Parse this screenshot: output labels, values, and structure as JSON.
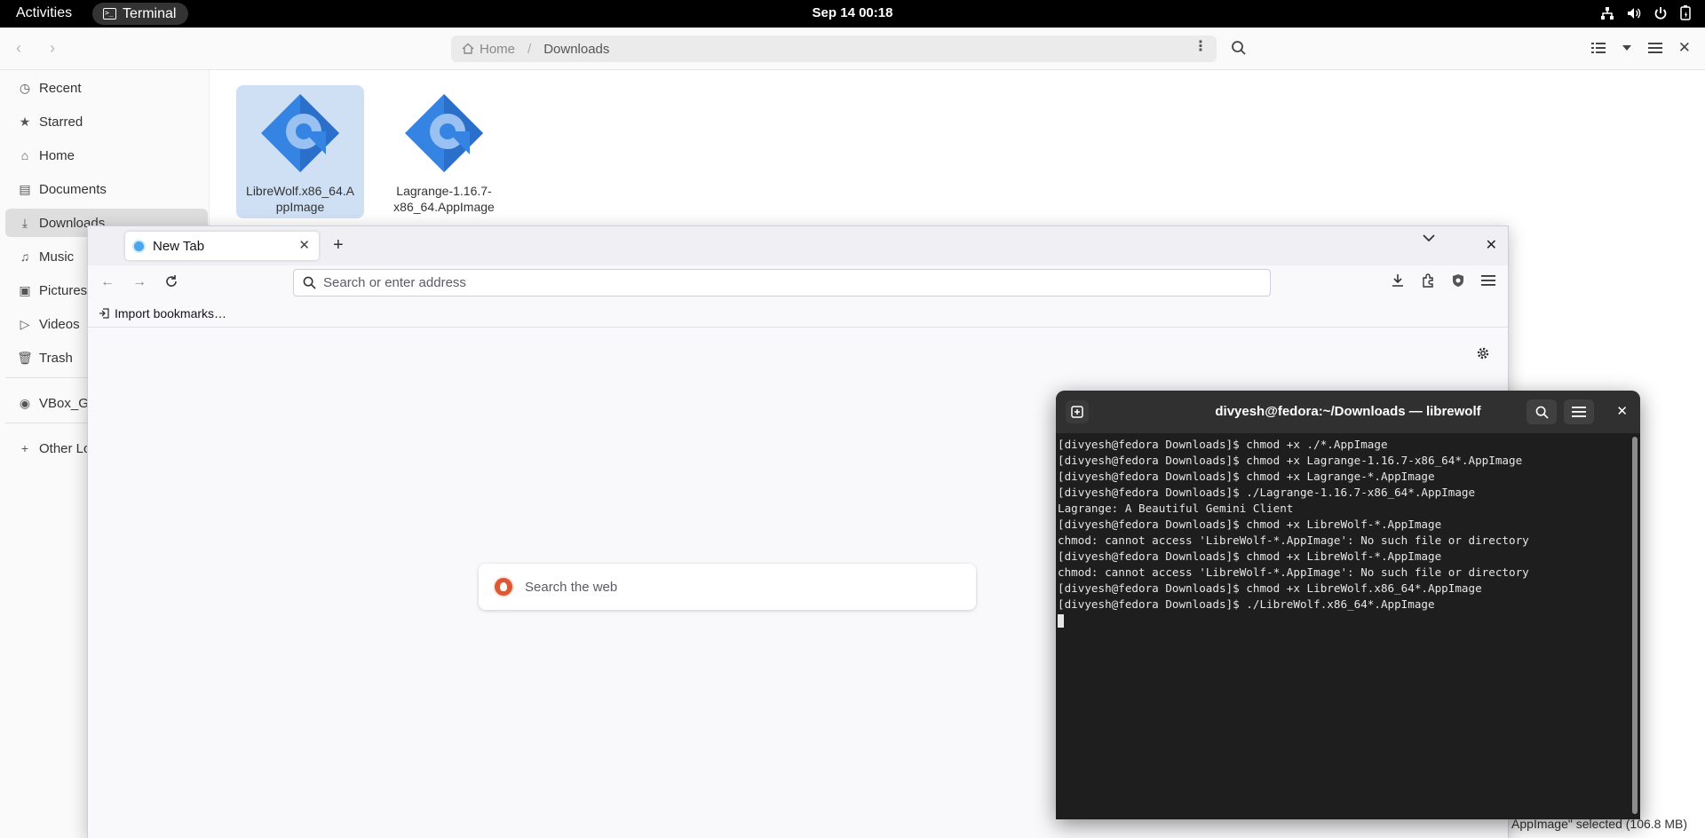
{
  "topbar": {
    "activities": "Activities",
    "app_name": "Terminal",
    "clock": "Sep 14  00:18",
    "tray_icons": [
      "network-icon",
      "volume-icon",
      "power-icon",
      "battery-icon"
    ]
  },
  "files": {
    "path_home": "Home",
    "path_current": "Downloads",
    "sidebar": [
      {
        "label": "Recent",
        "icon": "clock-icon"
      },
      {
        "label": "Starred",
        "icon": "star-icon"
      },
      {
        "label": "Home",
        "icon": "home-icon"
      },
      {
        "label": "Documents",
        "icon": "document-icon"
      },
      {
        "label": "Downloads",
        "icon": "download-icon"
      },
      {
        "label": "Music",
        "icon": "music-icon"
      },
      {
        "label": "Pictures",
        "icon": "picture-icon"
      },
      {
        "label": "Videos",
        "icon": "video-icon"
      },
      {
        "label": "Trash",
        "icon": "trash-icon"
      },
      {
        "label": "VBox_GA",
        "icon": "disc-icon"
      },
      {
        "label": "Other Lo",
        "icon": "plus-icon"
      }
    ],
    "items": [
      {
        "name": "LibreWolf.x86_64.AppImage",
        "name_lines": [
          "LibreWolf.x86_64.A",
          "ppImage"
        ],
        "selected": true
      },
      {
        "name": "Lagrange-1.16.7-x86_64.AppImage",
        "name_lines": [
          "Lagrange-1.16.7-",
          "x86_64.AppImage"
        ],
        "selected": false
      }
    ],
    "status": "AppImage\" selected (106.8 MB)"
  },
  "browser": {
    "tab_title": "New Tab",
    "url_placeholder": "Search or enter address",
    "bookmark_import": "Import bookmarks…",
    "web_search_placeholder": "Search the web"
  },
  "terminal": {
    "title": "divyesh@fedora:~/Downloads — librewolf",
    "lines": [
      "[divyesh@fedora Downloads]$ chmod +x ./*.AppImage",
      "[divyesh@fedora Downloads]$ chmod +x Lagrange-1.16.7-x86_64*.AppImage",
      "[divyesh@fedora Downloads]$ chmod +x Lagrange-*.AppImage",
      "[divyesh@fedora Downloads]$ ./Lagrange-1.16.7-x86_64*.AppImage",
      "Lagrange: A Beautiful Gemini Client",
      "[divyesh@fedora Downloads]$ chmod +x LibreWolf-*.AppImage",
      "chmod: cannot access 'LibreWolf-*.AppImage': No such file or directory",
      "[divyesh@fedora Downloads]$ chmod +x LibreWolf-*.AppImage",
      "chmod: cannot access 'LibreWolf-*.AppImage': No such file or directory",
      "[divyesh@fedora Downloads]$ chmod +x LibreWolf.x86_64*.AppImage",
      "[divyesh@fedora Downloads]$ ./LibreWolf.x86_64*.AppImage"
    ]
  },
  "colors": {
    "selection": "#cfe0f5",
    "appimage_icon": "#3584e4",
    "terminal_bg": "#1e1e1e"
  }
}
